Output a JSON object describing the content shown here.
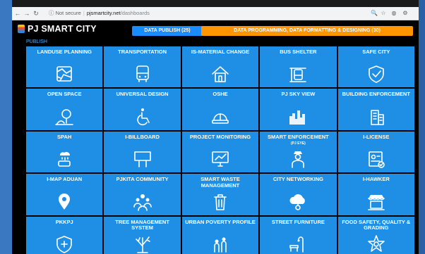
{
  "browser": {
    "nav_icons": [
      "←",
      "→",
      "↻"
    ],
    "security": "ⓘ Not secure",
    "host": "pjsmartcity.net",
    "path": "/dashboards",
    "right_icons": [
      "🔍",
      "☆",
      "◍",
      "⚙"
    ]
  },
  "header": {
    "logo_text": "PJ SMART CITY",
    "tabs": [
      {
        "label": "DATA PUBLISH (25)",
        "color": "#1a8cff"
      },
      {
        "label": "DATA PROGRAMMING, DATA FORMATTING & DESIGNING (30)",
        "color": "#ff9500"
      }
    ]
  },
  "section": {
    "label": "PUBLISH"
  },
  "tiles": [
    {
      "label": "LANDUSE PLANNING",
      "icon": "map-icon"
    },
    {
      "label": "TRANSPORTATION",
      "icon": "bus-icon"
    },
    {
      "label": "IS-MATERIAL CHANGE",
      "icon": "house-icon"
    },
    {
      "label": "BUS SHELTER",
      "icon": "bus-shelter-icon"
    },
    {
      "label": "SAFE CITY",
      "icon": "shield-check-icon"
    },
    {
      "label": "OPEN SPACE",
      "icon": "tree-icon"
    },
    {
      "label": "UNIVERSAL DESIGN",
      "icon": "wheelchair-icon"
    },
    {
      "label": "OSHE",
      "icon": "hard-hat-icon"
    },
    {
      "label": "PJ SKY VIEW",
      "icon": "skyline-icon"
    },
    {
      "label": "BUILDING ENFORCEMENT",
      "icon": "building-icon"
    },
    {
      "label": "SPAH",
      "icon": "rain-tank-icon"
    },
    {
      "label": "I-BILLBOARD",
      "icon": "billboard-icon"
    },
    {
      "label": "PROJECT MONITORING",
      "icon": "monitor-chart-icon"
    },
    {
      "label": "SMART ENFORCEMENT",
      "sub": "(PJ EYE)",
      "icon": "officer-icon"
    },
    {
      "label": "I-LICENSE",
      "icon": "license-icon"
    },
    {
      "label": "I-MAP ADUAN",
      "icon": "map-pin-icon"
    },
    {
      "label": "PJKITA COMMUNITY",
      "icon": "community-icon"
    },
    {
      "label": "SMART WASTE MANAGEMENT",
      "icon": "trash-bin-icon"
    },
    {
      "label": "CITY NETWORKING",
      "icon": "cloud-network-icon"
    },
    {
      "label": "I-HAWKER",
      "icon": "hawker-stall-icon"
    },
    {
      "label": "PKKPJ",
      "icon": "shield-plus-icon"
    },
    {
      "label": "TREE MANAGEMENT SYSTEM",
      "icon": "bare-tree-icon"
    },
    {
      "label": "URBAN POVERTY PROFILE",
      "icon": "people-icon"
    },
    {
      "label": "STREET FURNITURE",
      "icon": "bench-lamp-icon"
    },
    {
      "label": "FOOD SAFETY, QUALITY & GRADING",
      "icon": "star-badge-icon"
    }
  ]
}
